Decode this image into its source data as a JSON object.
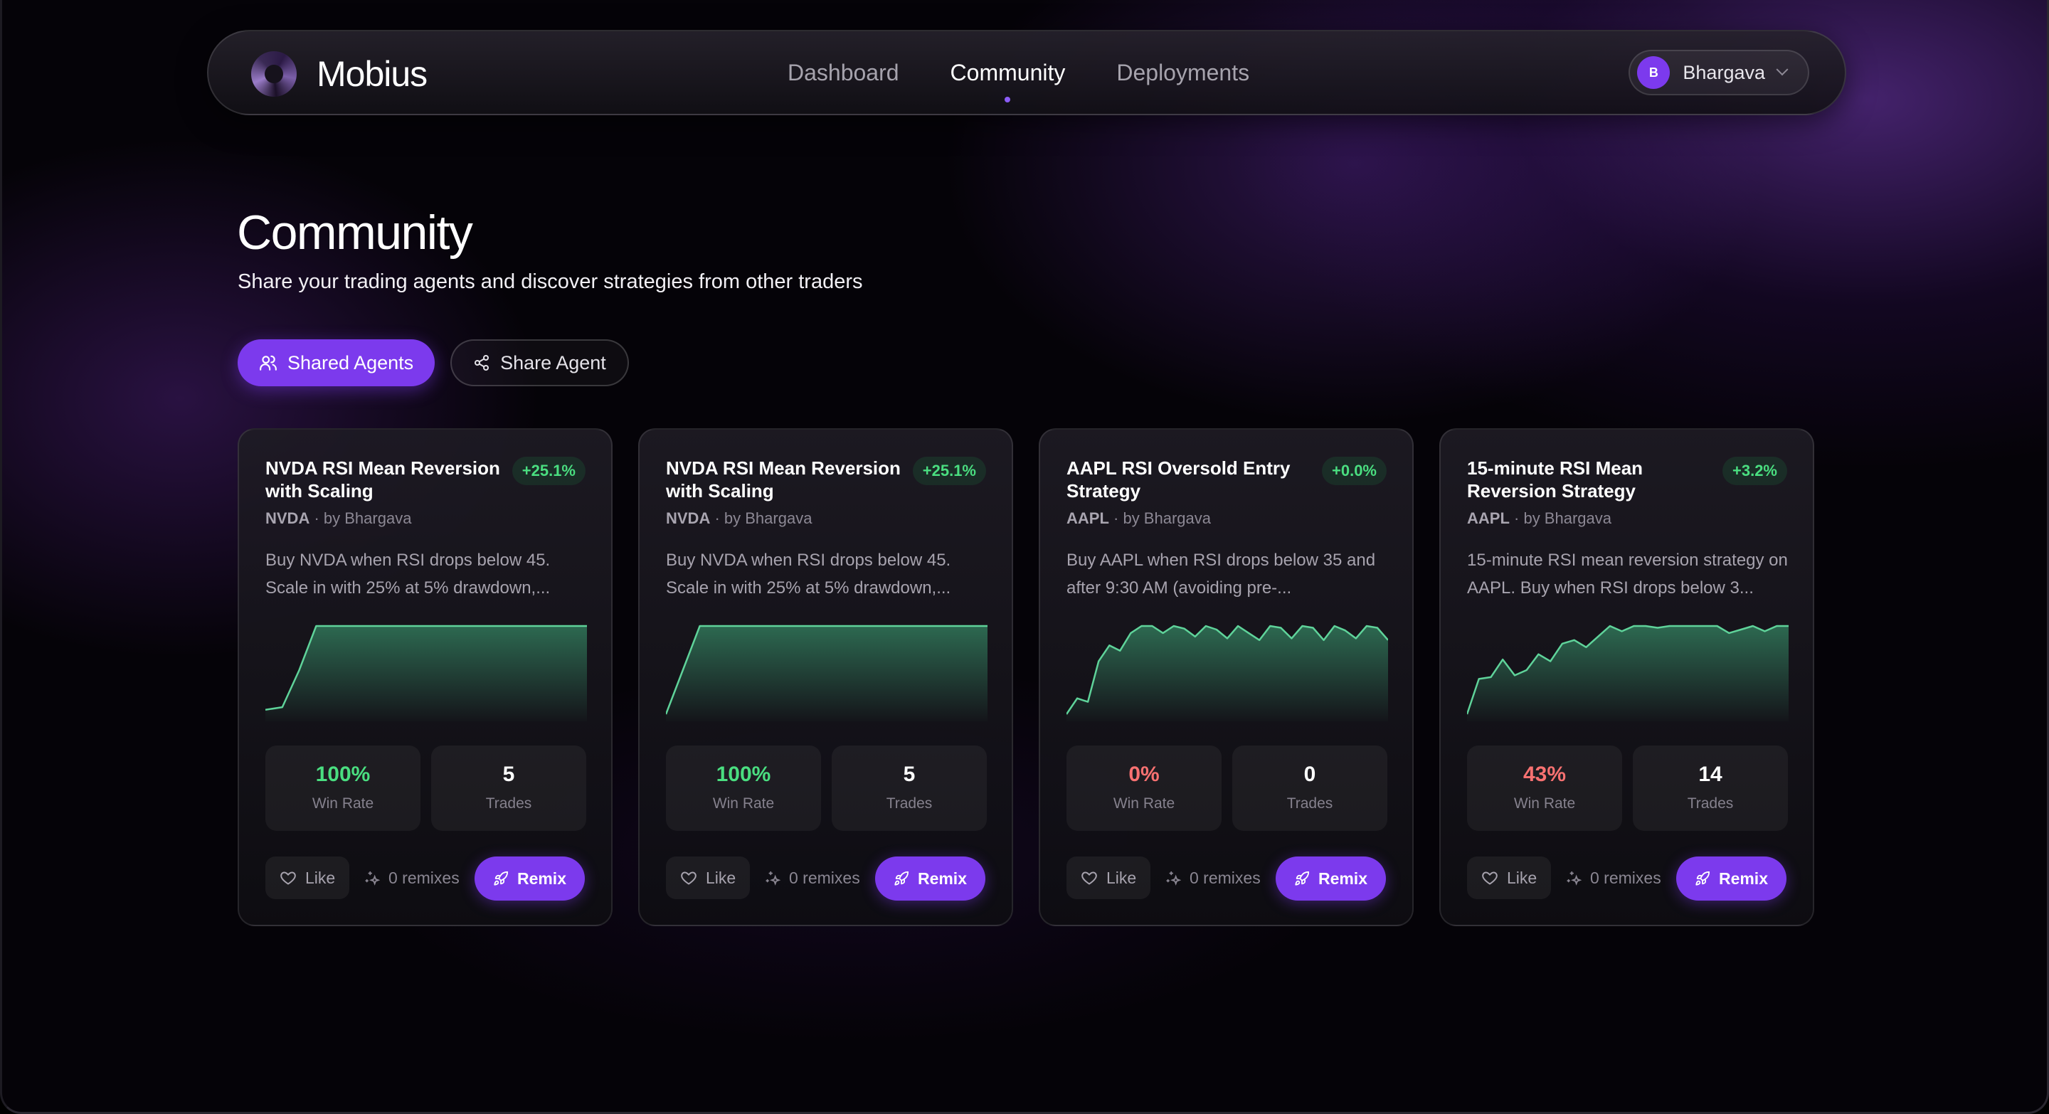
{
  "app": {
    "name": "Mobius"
  },
  "nav": {
    "links": [
      {
        "label": "Dashboard",
        "active": false
      },
      {
        "label": "Community",
        "active": true
      },
      {
        "label": "Deployments",
        "active": false
      }
    ],
    "user": {
      "initial": "B",
      "name": "Bhargava"
    }
  },
  "page": {
    "title": "Community",
    "subtitle": "Share your trading agents and discover strategies from other traders"
  },
  "tabs": {
    "shared_agents": "Shared Agents",
    "share_agent": "Share Agent"
  },
  "colors": {
    "accent": "#7c3aed",
    "positive": "#4ade80",
    "negative": "#f87171",
    "chart_line": "#5fd39a"
  },
  "cards": [
    {
      "title": "NVDA RSI Mean Reversion with Scaling",
      "return": "+25.1%",
      "ticker": "NVDA",
      "author": "by Bhargava",
      "description": "Buy NVDA when RSI drops below 45. Scale in with 25% at 5% drawdown,...",
      "equity_curve": [
        5,
        8,
        50,
        100,
        100,
        100,
        100,
        100,
        100,
        100,
        100,
        100,
        100,
        100,
        100,
        100,
        100,
        100,
        100,
        100
      ],
      "win_rate": "100%",
      "win_rate_status": "positive",
      "win_rate_label": "Win Rate",
      "trades": "5",
      "trades_label": "Trades",
      "like_label": "Like",
      "remixes": "0 remixes",
      "remix_label": "Remix"
    },
    {
      "title": "NVDA RSI Mean Reversion with Scaling",
      "return": "+25.1%",
      "ticker": "NVDA",
      "author": "by Bhargava",
      "description": "Buy NVDA when RSI drops below 45. Scale in with 25% at 5% drawdown,...",
      "equity_curve": [
        0,
        50,
        100,
        100,
        100,
        100,
        100,
        100,
        100,
        100,
        100,
        100,
        100,
        100,
        100,
        100,
        100,
        100,
        100,
        100
      ],
      "win_rate": "100%",
      "win_rate_status": "positive",
      "win_rate_label": "Win Rate",
      "trades": "5",
      "trades_label": "Trades",
      "like_label": "Like",
      "remixes": "0 remixes",
      "remix_label": "Remix"
    },
    {
      "title": "AAPL RSI Oversold Entry Strategy",
      "return": "+0.0%",
      "ticker": "AAPL",
      "author": "by Bhargava",
      "description": "Buy AAPL when RSI drops below 35 and after 9:30 AM (avoiding pre-...",
      "equity_curve": [
        0,
        18,
        14,
        60,
        78,
        72,
        92,
        100,
        100,
        92,
        100,
        97,
        88,
        100,
        96,
        86,
        100,
        92,
        84,
        100,
        98,
        86,
        100,
        98,
        84,
        100,
        95,
        86,
        100,
        98,
        84
      ],
      "win_rate": "0%",
      "win_rate_status": "negative",
      "win_rate_label": "Win Rate",
      "trades": "0",
      "trades_label": "Trades",
      "like_label": "Like",
      "remixes": "0 remixes",
      "remix_label": "Remix"
    },
    {
      "title": "15-minute RSI Mean Reversion Strategy",
      "return": "+3.2%",
      "ticker": "AAPL",
      "author": "by Bhargava",
      "description": "15-minute RSI mean reversion strategy on AAPL. Buy when RSI drops below 3...",
      "equity_curve": [
        0,
        40,
        42,
        62,
        44,
        50,
        68,
        60,
        80,
        84,
        76,
        88,
        100,
        94,
        100,
        100,
        98,
        100,
        100,
        100,
        100,
        100,
        92,
        96,
        100,
        94,
        100,
        100
      ],
      "win_rate": "43%",
      "win_rate_status": "negative",
      "win_rate_label": "Win Rate",
      "trades": "14",
      "trades_label": "Trades",
      "like_label": "Like",
      "remixes": "0 remixes",
      "remix_label": "Remix"
    }
  ]
}
